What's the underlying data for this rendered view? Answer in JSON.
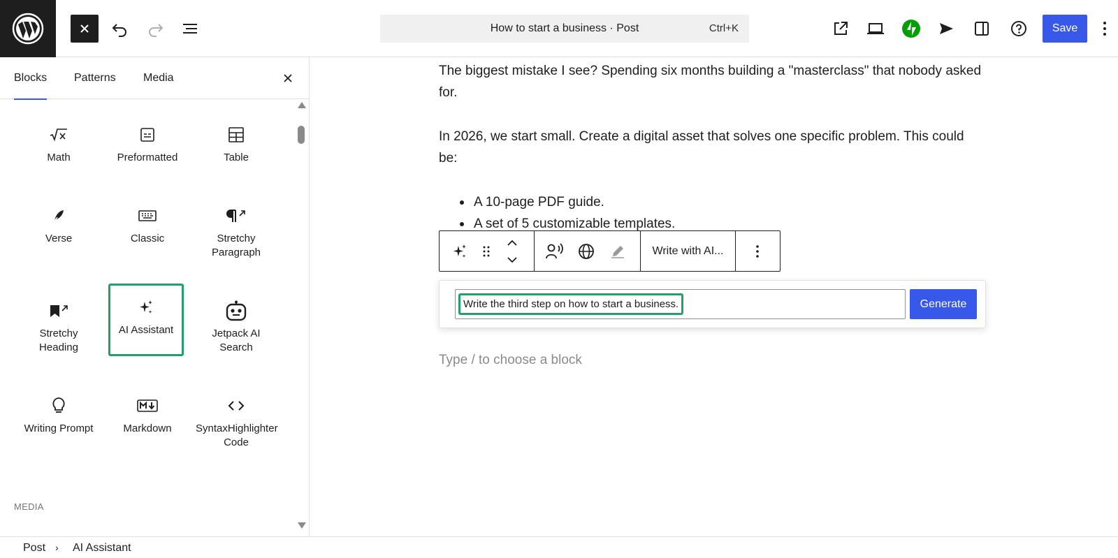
{
  "header": {
    "title": "How to start a business · Post",
    "shortcut": "Ctrl+K",
    "save_label": "Save"
  },
  "sidebar": {
    "tabs": [
      {
        "label": "Blocks",
        "active": true
      },
      {
        "label": "Patterns",
        "active": false
      },
      {
        "label": "Media",
        "active": false
      }
    ],
    "blocks": [
      {
        "label": "Math",
        "icon": "math-icon"
      },
      {
        "label": "Preformatted",
        "icon": "preformatted-icon"
      },
      {
        "label": "Table",
        "icon": "table-icon"
      },
      {
        "label": "Verse",
        "icon": "verse-icon"
      },
      {
        "label": "Classic",
        "icon": "keyboard-icon"
      },
      {
        "label": "Stretchy Paragraph",
        "icon": "paragraph-icon"
      },
      {
        "label": "Stretchy Heading",
        "icon": "bookmark-icon"
      },
      {
        "label": "AI Assistant",
        "icon": "sparkles-icon",
        "selected": true
      },
      {
        "label": "Jetpack AI Search",
        "icon": "robot-icon"
      },
      {
        "label": "Writing Prompt",
        "icon": "lightbulb-icon"
      },
      {
        "label": "Markdown",
        "icon": "markdown-icon"
      },
      {
        "label": "SyntaxHighlighter Code",
        "icon": "code-icon"
      }
    ],
    "section_label": "MEDIA"
  },
  "editor": {
    "paragraph1": "The biggest mistake I see? Spending six months building a \"masterclass\" that nobody asked for.",
    "paragraph2": "In 2026, we start small. Create a digital asset that solves one specific problem. This could be:",
    "list": [
      "A 10-page PDF guide.",
      "A set of 5 customizable templates."
    ],
    "toolbar": {
      "write_with_ai": "Write with AI..."
    },
    "ai_prompt": "Write the third step on how to start a business.",
    "generate_label": "Generate",
    "placeholder": "Type / to choose a block"
  },
  "footer": {
    "breadcrumb": [
      "Post",
      "AI Assistant"
    ]
  },
  "colors": {
    "accent": "#3858e9",
    "highlight": "#22a06b",
    "jetpack": "#069e08",
    "dark": "#1e1e1e"
  }
}
